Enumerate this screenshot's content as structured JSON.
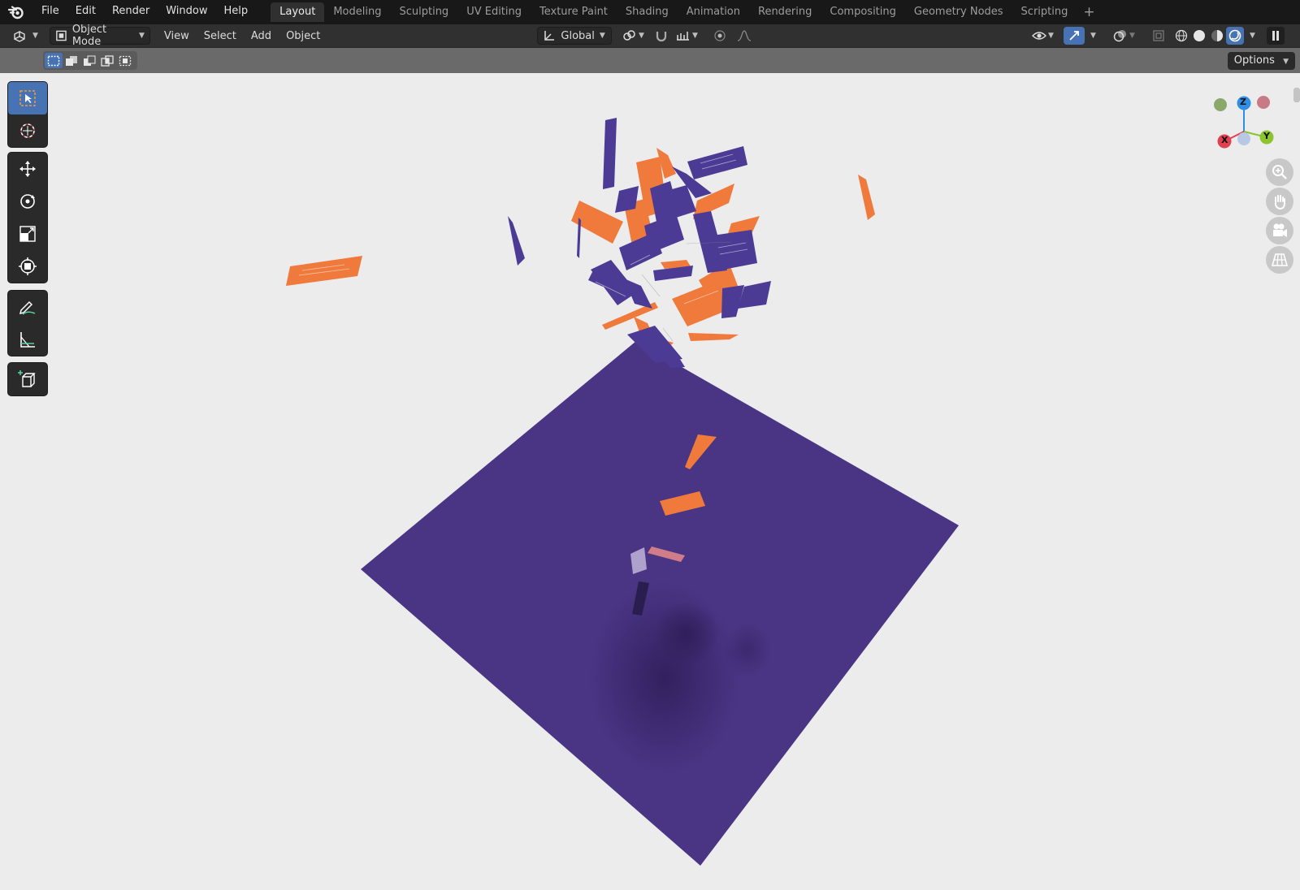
{
  "menu": {
    "items": [
      "File",
      "Edit",
      "Render",
      "Window",
      "Help"
    ]
  },
  "workspaces": {
    "tabs": [
      "Layout",
      "Modeling",
      "Sculpting",
      "UV Editing",
      "Texture Paint",
      "Shading",
      "Animation",
      "Rendering",
      "Compositing",
      "Geometry Nodes",
      "Scripting"
    ],
    "active": "Layout",
    "add_symbol": "+"
  },
  "header": {
    "mode_label": "Object Mode",
    "view_label": "View",
    "select_label": "Select",
    "add_label": "Add",
    "object_label": "Object",
    "orientation_label": "Global"
  },
  "toolstrip": {
    "options_label": "Options"
  },
  "toolbar": {
    "tools": [
      "select-box",
      "cursor",
      "move",
      "rotate",
      "scale",
      "transform",
      "annotate",
      "measure",
      "add-cube"
    ],
    "active": "select-box"
  },
  "gizmo": {
    "axes": [
      "X",
      "Y",
      "Z"
    ],
    "colors": {
      "x": "#e0404f",
      "y": "#8bc42e",
      "z": "#2f8ee6"
    }
  },
  "scene": {
    "plane_color": "#4a3585",
    "card_orange": "#ef7a3c",
    "card_purple": "#4b3b95",
    "background": "#ececec"
  }
}
